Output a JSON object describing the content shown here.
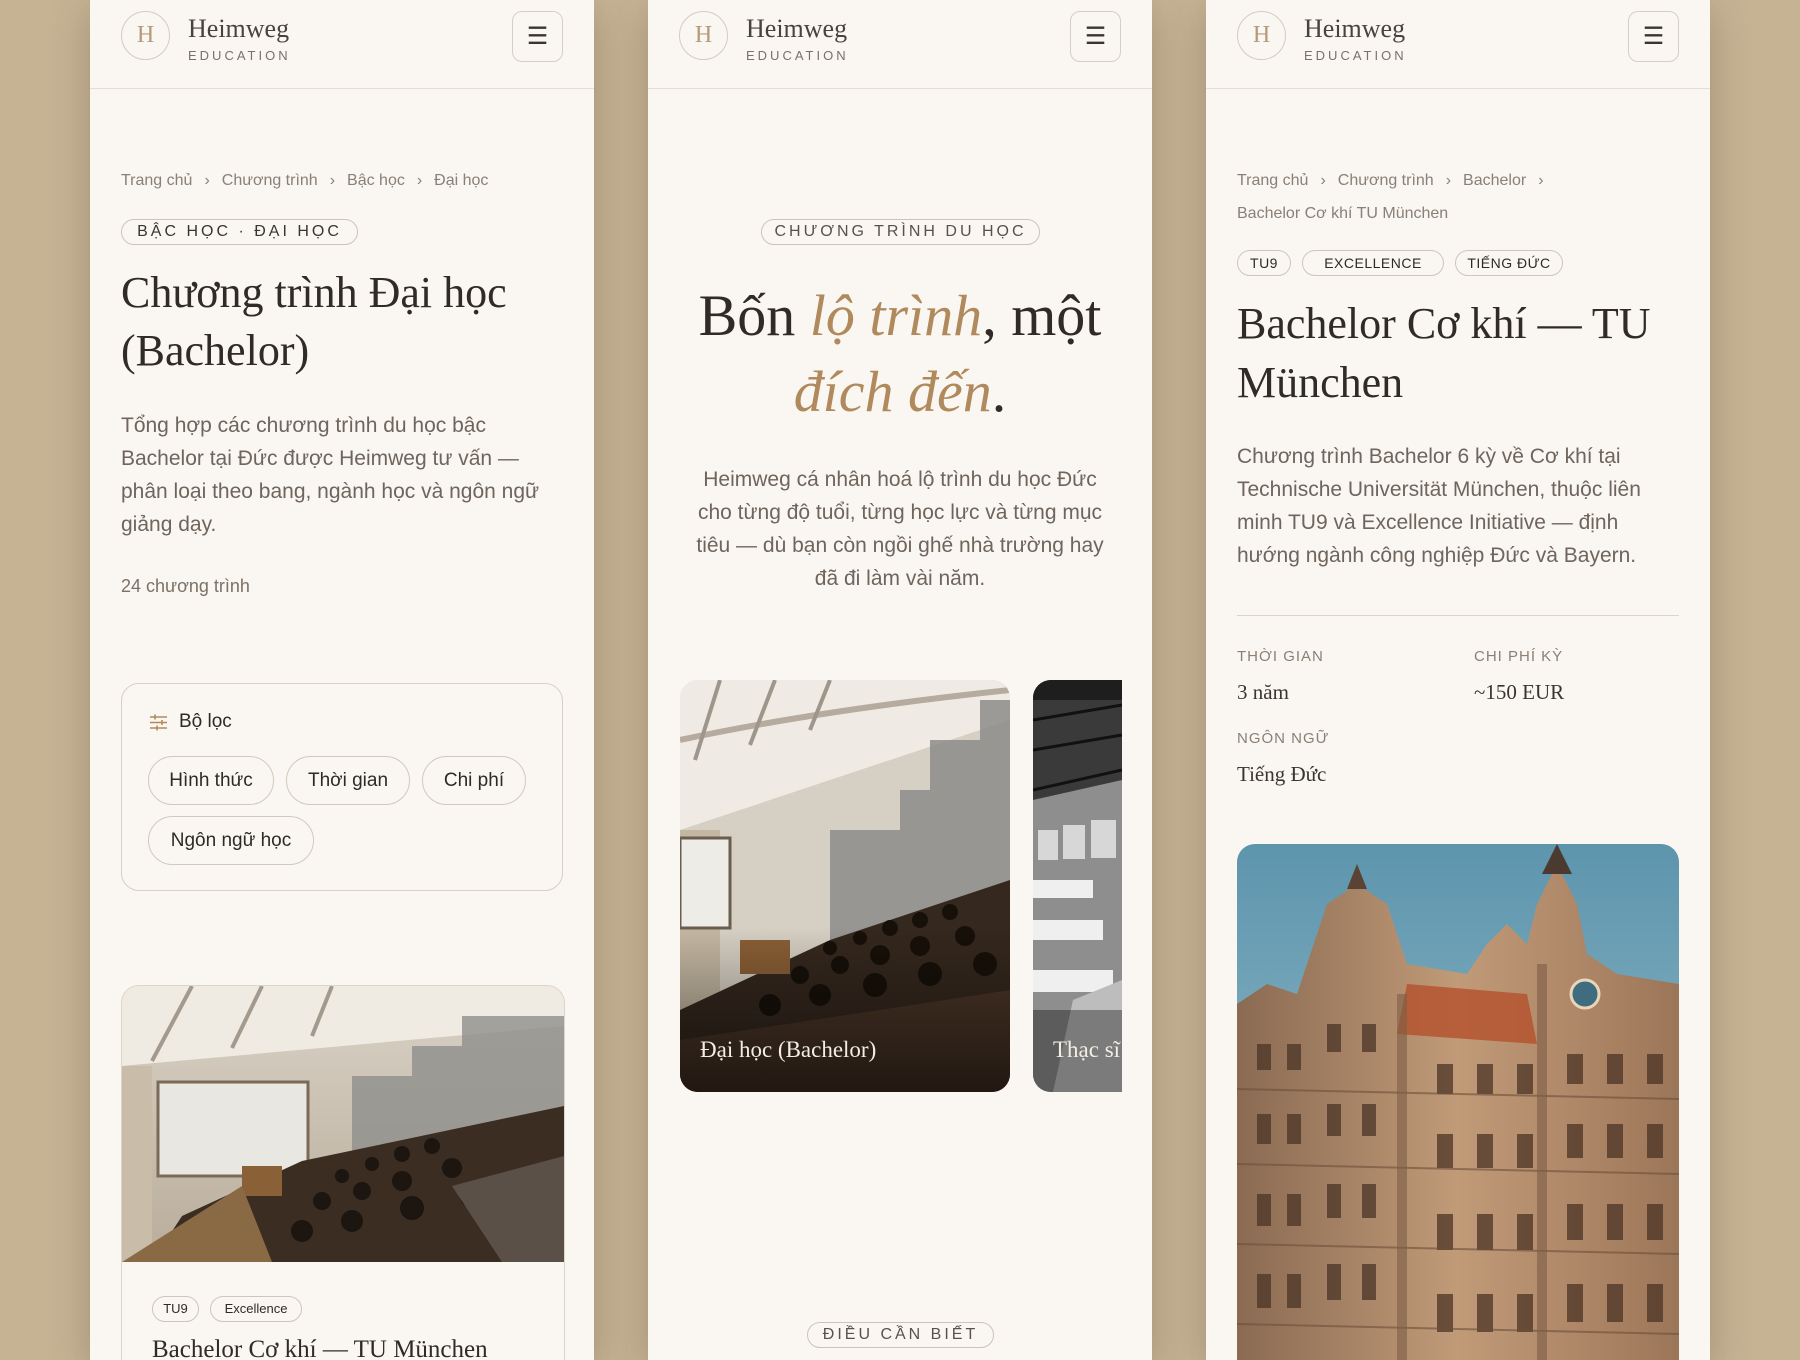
{
  "brand": {
    "mark": "H",
    "name": "Heimweg",
    "sub": "EDUCATION"
  },
  "menu_icon": "menu-icon",
  "screen1": {
    "breadcrumb": [
      "Trang chủ",
      "Chương trình",
      "Bậc học",
      "Đại học"
    ],
    "badge": "BẬC HỌC · ĐẠI HỌC",
    "title_line1": "Chương trình Đại học",
    "title_line2": "(Bachelor)",
    "desc_lines": [
      "Tổng hợp các chương trình du học bậc",
      "Bachelor tại Đức được Heimweg tư vấn —",
      "phân loại theo bang, ngành học và ngôn ngữ",
      "giảng dạy."
    ],
    "count": "24 chương trình",
    "filter": {
      "title": "Bộ lọc",
      "chips": [
        "Hình thức",
        "Thời gian",
        "Chi phí",
        "Ngôn ngữ học"
      ]
    },
    "card": {
      "tags": [
        "TU9",
        "Excellence"
      ],
      "title": "Bachelor Cơ khí — TU München"
    }
  },
  "screen2": {
    "eyebrow": "CHƯƠNG TRÌNH DU HỌC",
    "title_a": "Bốn ",
    "title_b": "lộ trình",
    "title_c": ", một",
    "title_d": "đích đến",
    "title_e": ".",
    "desc_lines": [
      "Heimweg cá nhân hoá lộ trình du học Đức",
      "cho từng độ tuổi, từng học lực và từng mục",
      "tiêu — dù bạn còn ngồi ghế nhà trường hay",
      "đã đi làm vài năm."
    ],
    "cards": [
      {
        "label": "Đại học (Bachelor)"
      },
      {
        "label": "Thạc sĩ"
      }
    ],
    "bottom_badge": "ĐIỀU CẦN BIẾT"
  },
  "screen3": {
    "breadcrumb": [
      "Trang chủ",
      "Chương trình",
      "Bachelor"
    ],
    "breadcrumb_current": "Bachelor Cơ khí TU München",
    "tags": [
      "TU9",
      "EXCELLENCE",
      "TIẾNG ĐỨC"
    ],
    "title_line1": "Bachelor Cơ khí — TU",
    "title_line2": "München",
    "desc_lines": [
      "Chương trình Bachelor 6 kỳ về Cơ khí tại",
      "Technische Universität München, thuộc liên",
      "minh TU9 và Excellence Initiative — định",
      "hướng ngành công nghiệp Đức và Bayern."
    ],
    "stats": [
      {
        "label": "THỜI GIAN",
        "value": "3 năm"
      },
      {
        "label": "CHI PHÍ KỲ",
        "value": "~150 EUR"
      },
      {
        "label": "NGÔN NGỮ",
        "value": "Tiếng Đức"
      }
    ]
  },
  "colors": {
    "accent": "#b08a5c",
    "background": "#faf6f1",
    "frame": "#c6b394"
  }
}
